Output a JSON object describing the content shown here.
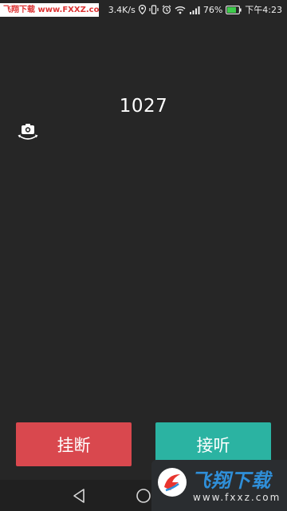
{
  "status_bar": {
    "watermark_text": "飞翔下载 www.FXXZ.com",
    "net_speed": "3.4K/s",
    "battery_percent": "76%",
    "time": "下午4:23",
    "icons": [
      "location-icon",
      "vibrate-icon",
      "alarm-icon",
      "wifi-icon",
      "signal-icon",
      "battery-icon"
    ]
  },
  "call": {
    "caller_id": "1027",
    "switch_camera_icon": "camera-rotate-icon"
  },
  "actions": {
    "hangup_label": "挂断",
    "answer_label": "接听"
  },
  "colors": {
    "background": "#262626",
    "hangup": "#d9484e",
    "answer": "#2bb3a2"
  },
  "nav_bar": {
    "icons": [
      "back-icon",
      "home-icon"
    ]
  },
  "watermark": {
    "title": "飞翔下载",
    "url": "www.fxxz.com"
  }
}
